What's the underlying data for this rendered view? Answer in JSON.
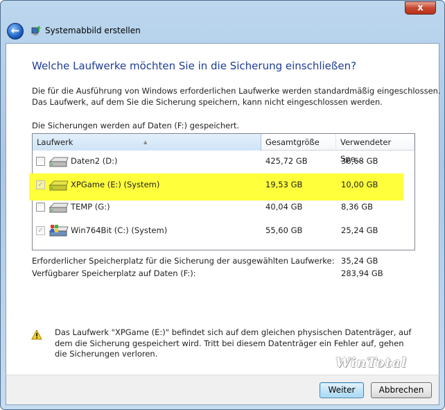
{
  "window": {
    "title": "Systemabbild erstellen",
    "close_label": "x"
  },
  "heading": "Welche Laufwerke möchten Sie in die Sicherung einschließen?",
  "description": [
    "Die für die Ausführung von Windows erforderlichen Laufwerke werden standardmäßig eingeschlossen.",
    "Das Laufwerk, auf dem Sie die Sicherung speichern, kann nicht eingeschlossen werden."
  ],
  "saved_to": "Die Sicherungen werden auf Daten (F:) gespeichert.",
  "table": {
    "columns": [
      "Laufwerk",
      "Gesamtgröße",
      "Verwendeter Spe..."
    ],
    "rows": [
      {
        "name": "Daten2 (D:)",
        "total": "425,72 GB",
        "used": "36,68 GB",
        "checked": false,
        "disabled": false,
        "icon": "hard-drive-icon"
      },
      {
        "name": "XPGame (E:) (System)",
        "total": "19,53 GB",
        "used": "10,00 GB",
        "checked": true,
        "disabled": true,
        "icon": "hard-drive-icon",
        "highlighted": true
      },
      {
        "name": "TEMP (G:)",
        "total": "40,04 GB",
        "used": "8,36 GB",
        "checked": false,
        "disabled": false,
        "icon": "hard-drive-icon"
      },
      {
        "name": "Win764Bit (C:) (System)",
        "total": "55,60 GB",
        "used": "25,24 GB",
        "checked": true,
        "disabled": true,
        "icon": "windows-drive-icon"
      }
    ]
  },
  "summary": [
    {
      "label": "Erforderlicher Speicherplatz für die Sicherung der ausgewählten Laufwerke:",
      "value": "35,24 GB"
    },
    {
      "label": "Verfügbarer Speicherplatz auf Daten (F:):",
      "value": "283,94 GB"
    }
  ],
  "warning": "Das Laufwerk \"XPGame (E:)\" befindet sich auf dem gleichen physischen Datenträger, auf dem die Sicherung gespeichert wird. Tritt bei diesem Datenträger ein Fehler auf, gehen die Sicherungen verloren.",
  "watermark": "WinTotal",
  "buttons": {
    "next": "Weiter",
    "cancel": "Abbrechen"
  },
  "colors": {
    "heading": "#1e3c96",
    "highlight": "#ffff3c"
  }
}
